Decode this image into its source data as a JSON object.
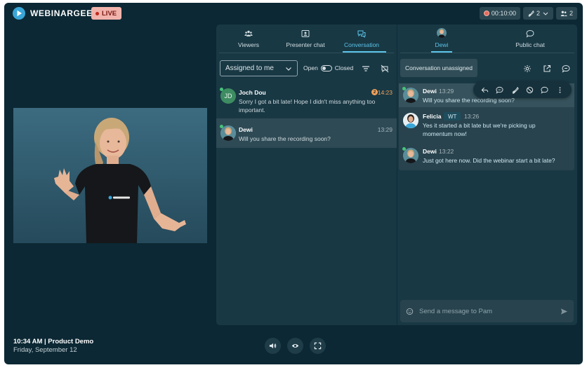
{
  "brand": {
    "name": "WEBINARGEEK"
  },
  "live_badge": "LIVE",
  "top_bar": {
    "timer": "00:10:00",
    "presenters_count": "2",
    "attendees_count": "2"
  },
  "meeting": {
    "time_title": "10:34 AM | Product Demo",
    "date": "Friday, September 12"
  },
  "chat_tabs": [
    {
      "label": "Viewers",
      "icon": "viewers-icon"
    },
    {
      "label": "Presenter chat",
      "icon": "presenter-chat-icon"
    },
    {
      "label": "Conversation",
      "icon": "conversation-icon",
      "active": true
    }
  ],
  "right_tabs": [
    {
      "label": "Dewi",
      "icon": "avatar",
      "active": true
    },
    {
      "label": "Public chat",
      "icon": "public-chat-icon"
    }
  ],
  "filter": {
    "assigned_label": "Assigned to me",
    "open_label": "Open",
    "closed_label": "Closed"
  },
  "conversations": [
    {
      "initials": "JD",
      "name": "Joch Dou",
      "time": "14:23",
      "unread": "2",
      "message": "Sorry I got a bit late! Hope I didn't miss anything too important."
    },
    {
      "name": "Dewi",
      "time": "13:29",
      "message": "Will you share the recording soon?"
    }
  ],
  "thread": {
    "status_button": "Conversation unassigned",
    "messages": [
      {
        "name": "Dewi",
        "time": "13:29",
        "text": "Will you share the recording soon?"
      },
      {
        "name": "Felicia",
        "badge": "WT",
        "time": "13:26",
        "text": "Yes it started a bit late but we're picking up momentum now!"
      },
      {
        "name": "Dewi",
        "time": "13:22",
        "text": "Just got here now. Did the webinar start a bit late?"
      }
    ]
  },
  "composer": {
    "placeholder": "Send a message to Pam"
  },
  "colors": {
    "accent": "#5cc4e8",
    "live": "#f1b4ac",
    "background": "#0c2834",
    "panel": "#183844",
    "unread": "#f0a35c",
    "online": "#46c37b"
  }
}
